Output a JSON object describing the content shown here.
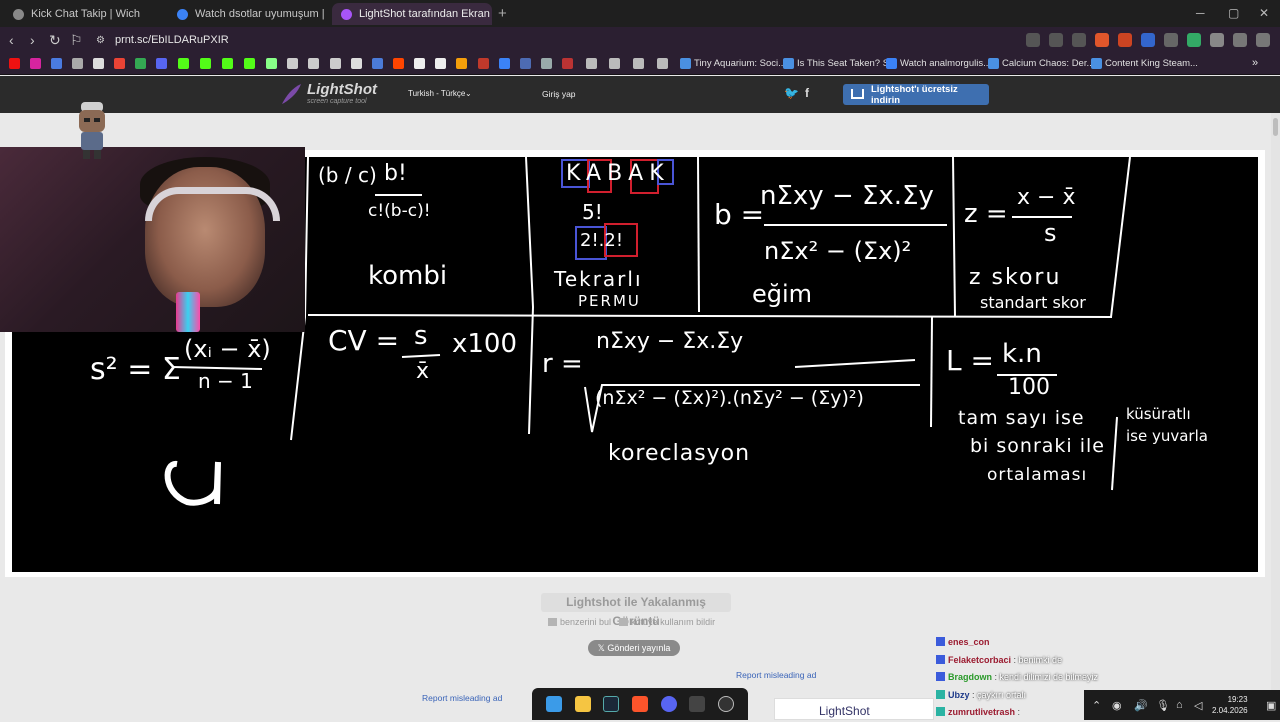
{
  "browser": {
    "tabs": [
      {
        "label": "Kick Chat Takip | Wich",
        "active": false,
        "color": "#888888"
      },
      {
        "label": "Watch dsotlar uyumuşum | Streamat",
        "active": false,
        "color": "#3b82f6"
      },
      {
        "label": "LightShot tarafından Ekran Görü",
        "active": true,
        "color": "#a855f7"
      }
    ],
    "new_tab": "+",
    "url": "prnt.sc/EbILDARuPXIR",
    "bookmarks": [
      {
        "label": "Tiny Aquarium: Soci...",
        "icon": "bookmark-icon"
      },
      {
        "label": "Is This Seat Taken? S...",
        "icon": "bookmark-icon"
      },
      {
        "label": "Watch analmorgulis...",
        "icon": "bookmark-icon"
      },
      {
        "label": "Calcium Chaos: Der...",
        "icon": "bookmark-icon"
      },
      {
        "label": "Content King Steam...",
        "icon": "bookmark-icon"
      }
    ]
  },
  "lightshot": {
    "logo": "LightShot",
    "logo_sub": "screen capture tool",
    "language": "Turkish - Türkçe",
    "login": "Giriş yap",
    "download": "Lightshot'ı ücretsiz indirin",
    "status": "Lightshot ile Yakalanmış Görüntü",
    "find_similar": "benzerini bul",
    "report_abuse": "kötüye kullanım bildir",
    "tweet": "Gönderi yayınla",
    "report_ad": "Report misleading ad",
    "footer_logo": "LightShot"
  },
  "whiteboard": {
    "comb_sym": "(b / c)",
    "comb_frac_top": "b!",
    "comb_frac_bottom": "c!(b-c)!",
    "comb_word": "kombi",
    "kabak": "KABAK",
    "perm_num": "5!",
    "perm_den": "2!.2!",
    "perm_word": "Tekrarlı",
    "perm_word2": "PERMU",
    "b_lhs": "b =",
    "b_num": "nΣxy − Σx.Σy",
    "b_den": "nΣx² − (Σx)²",
    "b_word": "eğim",
    "z_lhs": "z =",
    "z_num": "x − x̄",
    "z_den": "s",
    "z_word": "z skoru",
    "z_word2": "standart skor",
    "s2_lhs": "s² = Σ",
    "s2_num": "(xᵢ − x̄)",
    "s2_den": "n − 1",
    "cv_lhs": "CV =",
    "cv_num": "s",
    "cv_den": "x̄",
    "cv_tail": "x100",
    "r_lhs": "r =",
    "r_num": "nΣxy − Σx.Σy",
    "r_den": "(nΣx² − (Σx)²).(nΣy² − (Σy)²)",
    "r_word": "koreclasyon",
    "l_lhs": "L =",
    "l_num": "k.n",
    "l_den": "100",
    "l_note1": "tam sayı ise",
    "l_note2": "bi sonraki ile",
    "l_note3": "ortalaması",
    "l_note4": "küsüratlı",
    "l_note5": "ise yuvarla",
    "doodle": "a"
  },
  "chat": [
    {
      "user": "enes_con",
      "msg": "",
      "color": "#9b1b30"
    },
    {
      "user": "Felaketcorbaci",
      "msg": "benimki de",
      "color": "#9b1b30"
    },
    {
      "user": "Bragdown",
      "msg": "kendi dilimizi de bilmeyiz",
      "color": "#2a9a2a"
    },
    {
      "user": "Ubzy",
      "msg": "çaykırı ortalı",
      "color": "#1e3a8a"
    },
    {
      "user": "zumrutlivetrash",
      "msg": "",
      "color": "#9b1b30"
    }
  ],
  "taskbar": {
    "time": "19:23",
    "date": "2.04.2026"
  }
}
